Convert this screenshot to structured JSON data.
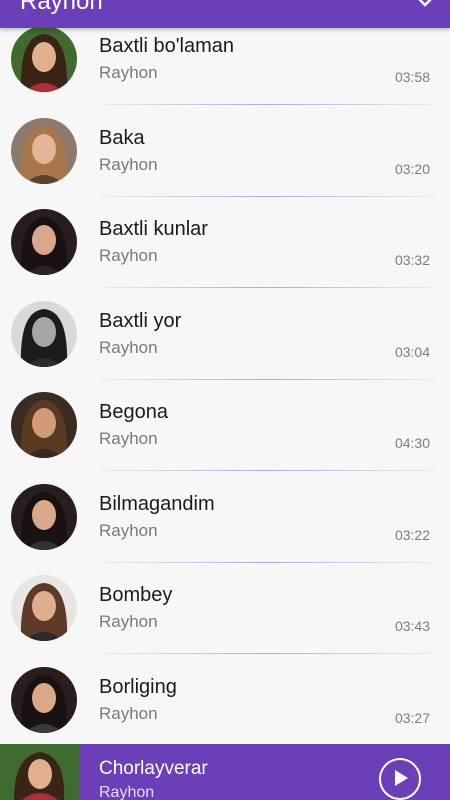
{
  "header": {
    "title": "Rayhon",
    "menu_icon": "chevron-down-icon"
  },
  "songs": [
    {
      "title": "Baxtli bo'laman",
      "artist": "Rayhon",
      "duration": "03:58",
      "avatar": {
        "bg": "#3f6b2e",
        "hair": "#3a2416",
        "skin": "#e2b08e",
        "cloth": "#b22d3c"
      }
    },
    {
      "title": "Baka",
      "artist": "Rayhon",
      "duration": "03:20",
      "avatar": {
        "bg": "#8e7a6c",
        "hair": "#a8764a",
        "skin": "#e3b596",
        "cloth": "#5a4233"
      }
    },
    {
      "title": "Baxtli kunlar",
      "artist": "Rayhon",
      "duration": "03:32",
      "avatar": {
        "bg": "#2a1d1d",
        "hair": "#1a1212",
        "skin": "#d9a789",
        "cloth": "#2b2424"
      }
    },
    {
      "title": "Baxtli yor",
      "artist": "Rayhon",
      "duration": "03:04",
      "avatar": {
        "bg": "#d9d9d9",
        "hair": "#1c1c1c",
        "skin": "#a6a6a6",
        "cloth": "#2c2c2c"
      }
    },
    {
      "title": "Begona",
      "artist": "Rayhon",
      "duration": "04:30",
      "avatar": {
        "bg": "#3b2b22",
        "hair": "#5a3a23",
        "skin": "#d29a76",
        "cloth": "#3a2a20"
      }
    },
    {
      "title": "Bilmagandim",
      "artist": "Rayhon",
      "duration": "03:22",
      "avatar": {
        "bg": "#2a1d1d",
        "hair": "#1a1212",
        "skin": "#dca88a",
        "cloth": "#333333"
      }
    },
    {
      "title": "Bombey",
      "artist": "Rayhon",
      "duration": "03:43",
      "avatar": {
        "bg": "#e9e5e3",
        "hair": "#5e3a28",
        "skin": "#e0ad8d",
        "cloth": "#2a2a2a"
      }
    },
    {
      "title": "Borliging",
      "artist": "Rayhon",
      "duration": "03:27",
      "avatar": {
        "bg": "#2a1d1d",
        "hair": "#1a1212",
        "skin": "#dca88a",
        "cloth": "#3a3a3a"
      }
    }
  ],
  "now_playing": {
    "title": "Chorlayverar",
    "artist": "Rayhon",
    "cover": {
      "bg": "#3f6b2e",
      "hair": "#3a2416",
      "skin": "#e2b08e",
      "cloth": "#b22d3c"
    },
    "play_icon": "play-icon"
  },
  "colors": {
    "accent": "#6a3fb8",
    "background": "#f7f7f7",
    "divider": "#b4a6dc"
  }
}
